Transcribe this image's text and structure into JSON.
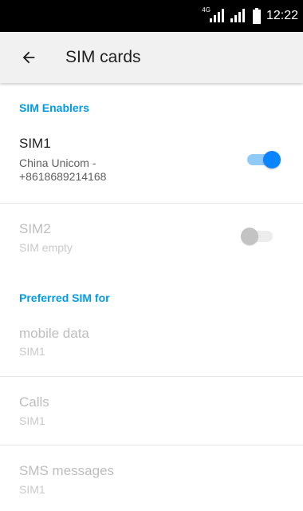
{
  "status_bar": {
    "network_type": "4G",
    "time": "12:22",
    "icons": [
      "sim1-signal-icon",
      "sim2-signal-icon",
      "battery-icon"
    ]
  },
  "app_bar": {
    "back_icon": "arrow-back-icon",
    "title": "SIM cards"
  },
  "sections": {
    "sim_enablers": {
      "header": "SIM Enablers"
    },
    "preferred_sim": {
      "header": "Preferred SIM for"
    }
  },
  "sim_cards": [
    {
      "title": "SIM1",
      "summary": "China Unicom -\n+8618689214168",
      "enabled": true,
      "toggle_on": true
    },
    {
      "title": "SIM2",
      "summary": "SIM empty",
      "enabled": false,
      "toggle_on": false
    }
  ],
  "preferences": [
    {
      "title": "mobile data",
      "summary": "SIM1"
    },
    {
      "title": "Calls",
      "summary": "SIM1"
    },
    {
      "title": "SMS messages",
      "summary": "SIM1"
    }
  ],
  "colors": {
    "accent": "#039be5",
    "switch_on": "#0a84ff",
    "status_bar": "#000000",
    "app_bar": "#f1f1f1",
    "disabled_text": "#bdbdbd"
  }
}
